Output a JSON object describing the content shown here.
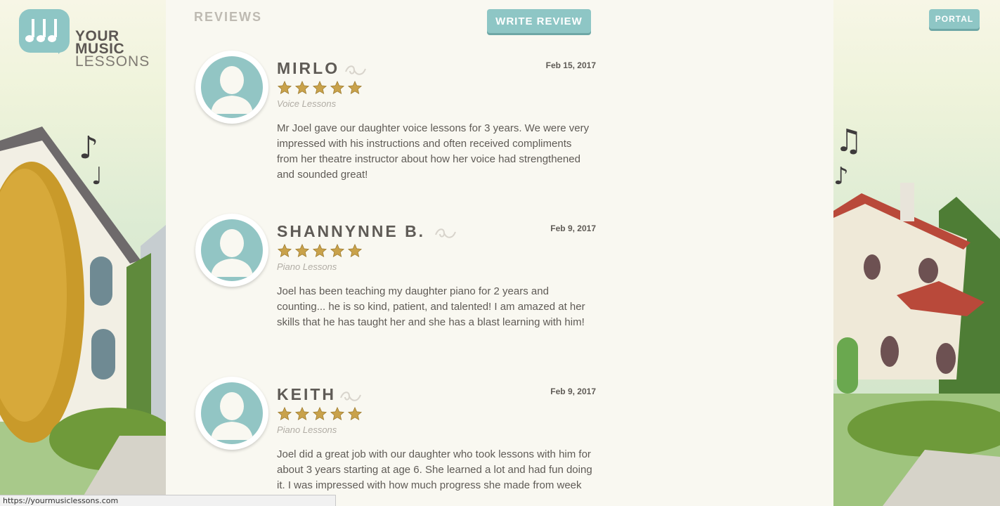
{
  "brand": {
    "line1": "YOUR",
    "line2": "MUSIC",
    "line3": "LESSONS"
  },
  "header": {
    "portal_label": "PORTAL"
  },
  "reviews_section": {
    "title": "REVIEWS",
    "write_review_label": "WRITE REVIEW",
    "items": [
      {
        "name": "MIRLO",
        "date": "Feb 15, 2017",
        "rating": 5,
        "lesson": "Voice Lessons",
        "text": "Mr Joel gave our daughter voice lessons for 3 years. We were very impressed with his instructions and often received compliments from her theatre instructor about how her voice had strengthened and sounded great!"
      },
      {
        "name": "SHANNYNNE B.",
        "date": "Feb 9, 2017",
        "rating": 5,
        "lesson": "Piano Lessons",
        "text": "Joel has been teaching my daughter piano for 2 years and counting... he is so kind, patient, and talented! I am amazed at her skills that he has taught her and she has a blast learning with him!"
      },
      {
        "name": "KEITH",
        "date": "Feb 9, 2017",
        "rating": 5,
        "lesson": "Piano Lessons",
        "text": "Joel did a great job with our daughter who took lessons with him for about 3 years starting at age 6. She learned a lot and had fun doing it. I was impressed with how much progress she made from week to week."
      }
    ]
  },
  "status_bar": {
    "url": "https://yourmusiclessons.com"
  },
  "colors": {
    "accent": "#8ec6c5",
    "content_bg": "#f9f8f1",
    "text": "#5f5b56",
    "star": "#c9a24b"
  }
}
